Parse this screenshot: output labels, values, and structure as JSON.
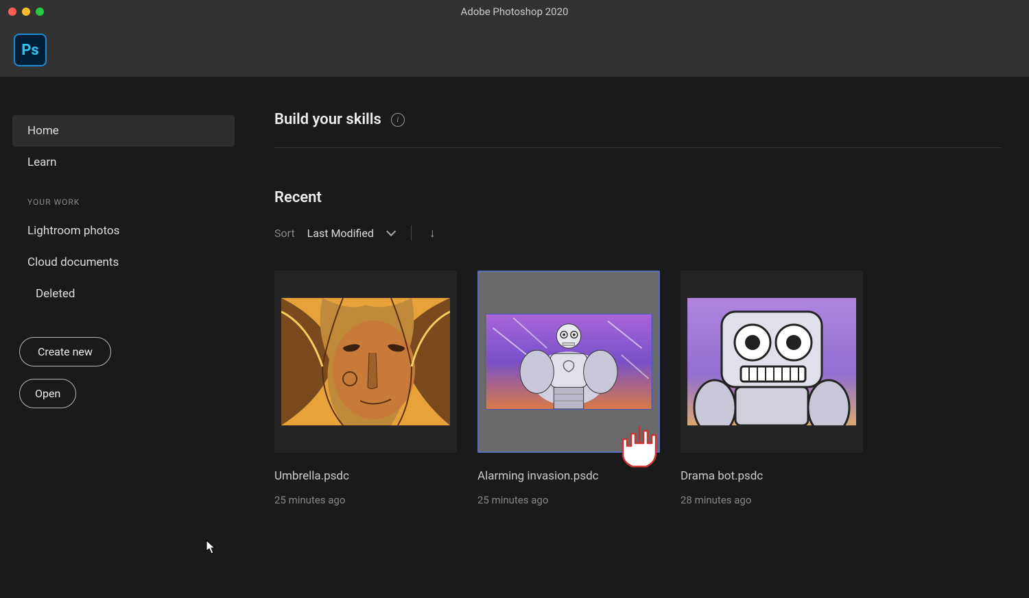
{
  "window": {
    "title": "Adobe Photoshop 2020"
  },
  "logo": {
    "text": "Ps"
  },
  "sidebar": {
    "items": [
      {
        "label": "Home",
        "active": true
      },
      {
        "label": "Learn",
        "active": false
      }
    ],
    "section_label": "YOUR WORK",
    "work_items": [
      {
        "label": "Lightroom photos"
      },
      {
        "label": "Cloud documents"
      },
      {
        "label": "Deleted",
        "indent": true
      }
    ],
    "create_label": "Create new",
    "open_label": "Open"
  },
  "content": {
    "skills_title": "Build your skills",
    "recent_title": "Recent",
    "sort_label": "Sort",
    "sort_value": "Last Modified"
  },
  "recent_files": [
    {
      "name": "Umbrella.psdc",
      "time": "25 minutes ago"
    },
    {
      "name": "Alarming invasion.psdc",
      "time": "25 minutes ago"
    },
    {
      "name": "Drama bot.psdc",
      "time": "28 minutes ago"
    }
  ]
}
